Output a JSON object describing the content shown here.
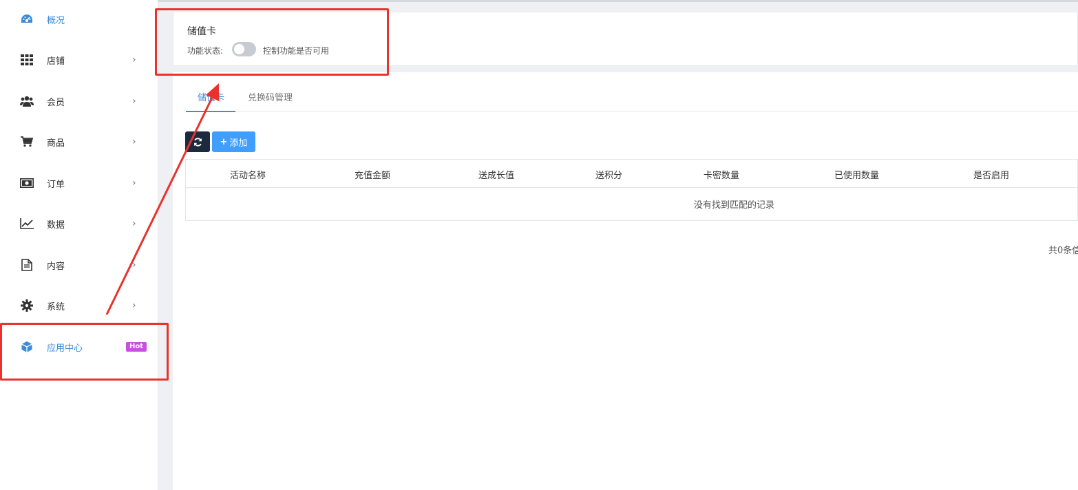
{
  "sidebar": {
    "items": [
      {
        "label": "概况",
        "icon": "dashboard-icon",
        "active": true
      },
      {
        "label": "店铺",
        "icon": "grid-icon"
      },
      {
        "label": "会员",
        "icon": "users-icon"
      },
      {
        "label": "商品",
        "icon": "cart-icon"
      },
      {
        "label": "订单",
        "icon": "money-icon"
      },
      {
        "label": "数据",
        "icon": "line-chart-icon"
      },
      {
        "label": "内容",
        "icon": "document-icon"
      },
      {
        "label": "系统",
        "icon": "gear-icon"
      },
      {
        "label": "应用中心",
        "icon": "cube-icon",
        "badge": "Hot",
        "active": true
      }
    ]
  },
  "status_card": {
    "title": "储值卡",
    "status_label": "功能状态:",
    "toggle_on": false,
    "description": "控制功能是否可用"
  },
  "tabs": [
    {
      "label": "储值卡",
      "active": true
    },
    {
      "label": "兑换码管理",
      "active": false
    }
  ],
  "toolbar": {
    "add_label": "添加"
  },
  "table": {
    "columns": [
      "活动名称",
      "充值金额",
      "送成长值",
      "送积分",
      "卡密数量",
      "已使用数量",
      "是否启用"
    ],
    "empty_message": "没有找到匹配的记录"
  },
  "pagination": {
    "total_text": "共0条信"
  },
  "colors": {
    "accent": "#3d8bd9",
    "annotation_red": "#e8322b",
    "hot_badge": "#c94fe0"
  }
}
